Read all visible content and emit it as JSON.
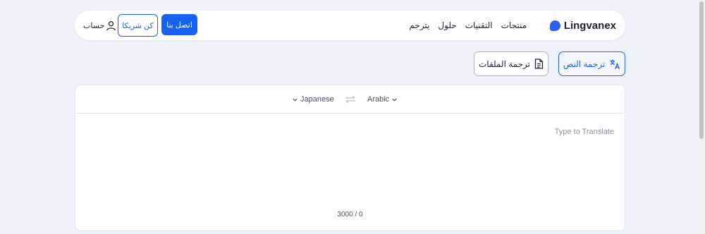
{
  "header": {
    "logo_text": "Lingvanex",
    "nav": [
      "منتجات",
      "التقنيات",
      "حلول",
      "يترجم"
    ],
    "contact_label": "اتصل بنا",
    "partner_label": "كن شريكا",
    "account_label": "حساب"
  },
  "modes": {
    "text_label": "ترجمة النص",
    "files_label": "ترجمة الملفات"
  },
  "translator": {
    "source_language": "Japanese",
    "target_language": "Arabic",
    "placeholder": "Type to Translate",
    "counter": "3000 / 0"
  },
  "colors": {
    "accent": "#1463f3",
    "background": "#eef2fa"
  }
}
